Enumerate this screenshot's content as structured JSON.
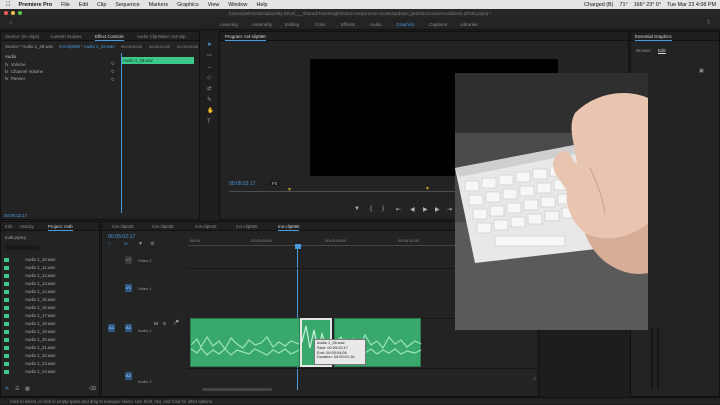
{
  "menubar": {
    "app_name": "Premiere Pro",
    "menus": [
      "File",
      "Edit",
      "Clip",
      "Sequence",
      "Markers",
      "Graphics",
      "View",
      "Window",
      "Help"
    ],
    "status_items": [
      "Charged (B)",
      "71°",
      "166° 23° 0°",
      "Tue Mar 23 4:08 PM"
    ]
  },
  "path_title": "/Users/joelhirst/Dropbox/My Drive/___Shared/TuneInsight/react-components-course/updates_jan2021/course/modules/4.2/m4b.prproj *",
  "workspaces": [
    "Learning",
    "Assembly",
    "Editing",
    "Color",
    "Effects",
    "Audio",
    "Graphics",
    "Captions",
    "Libraries"
  ],
  "active_workspace": "Graphics",
  "source_panel": {
    "tabs": [
      "Source: (no clips)",
      "Lumetri Scopes",
      "Effect Controls",
      "Audio Clip Mixer: m4-clip"
    ],
    "active_tab": "Effect Controls",
    "source_selector": "Source * Audio 1_28.wav",
    "sequence_selector": "m4-clip060 * Audio 1_28.wav",
    "ruler": [
      "00:00:00:00",
      "00:00:04:00",
      "00:00:08:00"
    ],
    "section": "Audio",
    "rows": [
      "Volume",
      "Channel Volume",
      "Panner"
    ],
    "clip_label": "Audio 1_28.wav",
    "bottom_timecode": "00:05:02:17"
  },
  "program_panel": {
    "title": "Program: m4-clip060",
    "timecode": "00:05:02:17",
    "fit_label": "Fit"
  },
  "project_panel": {
    "tabs": [
      "Info",
      "History",
      "Project: m4b"
    ],
    "active_tab": "Project: m4b",
    "file_name": "m4b.prproj",
    "items": [
      "Audio 1_10.wav",
      "Audio 1_11.wav",
      "Audio 1_12.wav",
      "Audio 1_13.wav",
      "Audio 1_14.wav",
      "Audio 1_15.wav",
      "Audio 1_16.wav",
      "Audio 1_17.wav",
      "Audio 1_18.wav",
      "Audio 1_19.wav",
      "Audio 1_20.wav",
      "Audio 1_21.wav",
      "Audio 1_22.wav",
      "Audio 1_23.wav",
      "Audio 1_24.wav"
    ]
  },
  "timeline": {
    "tabs": [
      "m4-clip020",
      "m4-clip030",
      "m4-clip040",
      "m4-clip050",
      "m4-clip060"
    ],
    "active_tab": "m4-clip060",
    "timecode": "00:05:02:17",
    "ruler": [
      "05:00",
      "00:05:00:00",
      "00:05:05:00",
      "00:05:10:00"
    ],
    "tracks": {
      "v2": "V2",
      "v2_name": "Video 2",
      "v1": "V1",
      "v1_name": "Video 1",
      "a1": "A1",
      "a1_name": "Audio 1",
      "a2": "A2",
      "a2_name": "Audio 2"
    },
    "tooltip": {
      "name": "Audio 1_28.wav",
      "start": "Start: 00:05:02:17",
      "end": "End: 00:05:04:08",
      "duration": "Duration: 00:00:01:16"
    }
  },
  "essential_graphics": {
    "title": "Essential Graphics",
    "tabs": [
      "Browse",
      "Edit"
    ],
    "active_tab": "Edit"
  },
  "status_bar": "Click to select, or click in empty space and drag to marquee select. Use Shift, Opt, and Cmd for other options.",
  "colors": {
    "accent": "#4a9ae0",
    "audio_clip": "#39a86b",
    "label_green": "#3bc88a"
  }
}
